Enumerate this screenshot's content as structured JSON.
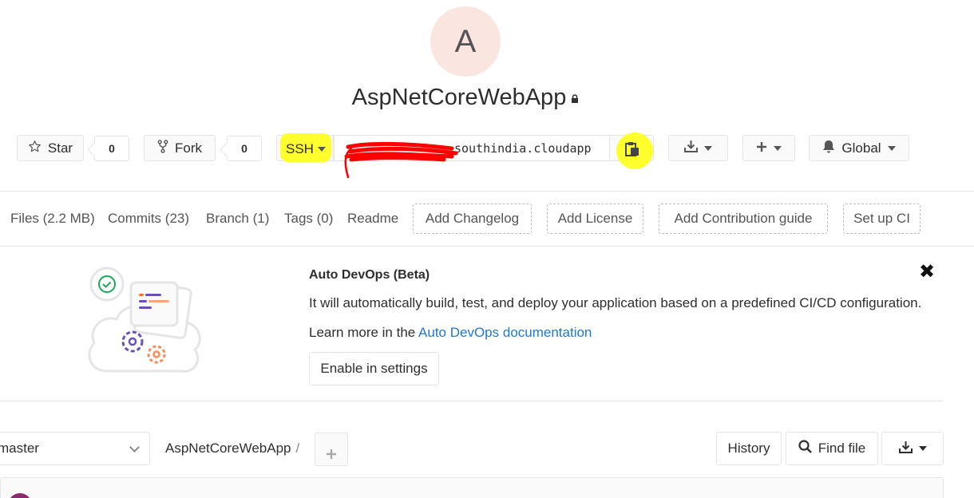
{
  "project": {
    "avatar_letter": "A",
    "name": "AspNetCoreWebApp"
  },
  "actions": {
    "star_label": "Star",
    "star_count": "0",
    "fork_label": "Fork",
    "fork_count": "0",
    "protocol": "SSH",
    "clone_url_visible": "southindia.cloudapp",
    "notification_label": "Global"
  },
  "nav": {
    "links": [
      "Files (2.2 MB)",
      "Commits (23)",
      "Branch (1)",
      "Tags (0)",
      "Readme"
    ],
    "dashed_buttons": [
      "Add Changelog",
      "Add License",
      "Add Contribution guide",
      "Set up CI"
    ]
  },
  "auto_devops": {
    "title": "Auto DevOps (Beta)",
    "description": "It will automatically build, test, and deploy your application based on a predefined CI/CD configuration.",
    "learn_prefix": "Learn more in the ",
    "learn_link": "Auto DevOps documentation",
    "button": "Enable in settings"
  },
  "tree": {
    "branch": "master",
    "path": "AspNetCoreWebApp",
    "separator": "/",
    "history": "History",
    "find_file": "Find file"
  },
  "colors": {
    "highlight": "#ffff2e",
    "link": "#1f78d1",
    "redaction": "#ff0000"
  }
}
